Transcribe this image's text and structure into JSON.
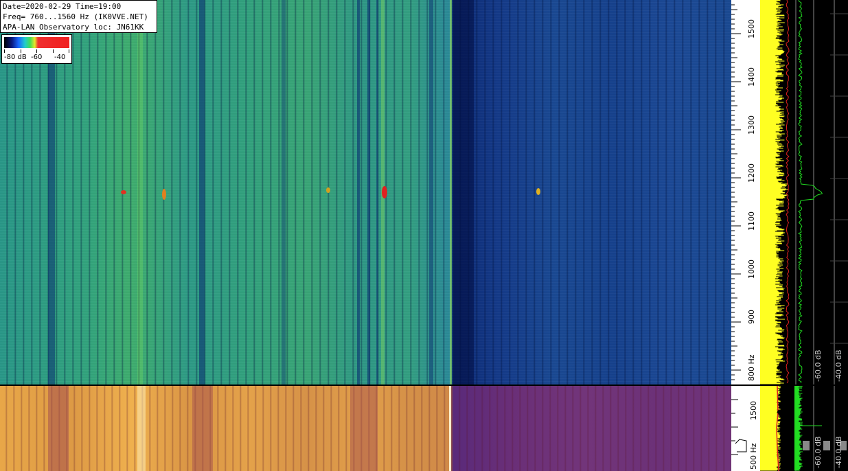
{
  "info": {
    "line1": "Date=2020-02-29 Time=19:00",
    "line2": "Freq= 760...1560 Hz (IK0VVE.NET)",
    "line3": "APA-LAN Observatory loc: JN61KK"
  },
  "legend": {
    "label_a": "-80 dB",
    "label_b": "-60",
    "label_c": "-40"
  },
  "axis_top": {
    "labels": [
      "1500",
      "1400",
      "1300",
      "1200",
      "1100",
      "1000",
      "900",
      "800 Hz"
    ]
  },
  "axis_bottom": {
    "labels": [
      "1500",
      "500 Hz"
    ]
  },
  "spectrum_top": {
    "db_left": "-60.0 dB",
    "db_right": "-40.0 dB"
  },
  "spectrum_bottom": {
    "db_left": "-60.0 dB",
    "db_right": "-40.0 dB"
  },
  "colors": {
    "wf_top_left": "#33a67f",
    "wf_top_right": "#1a4a94",
    "wf_bottom_left": "#e8a748",
    "wf_bottom_right": "#6c3178",
    "spectrum_yellow": "#ffff22",
    "spectrum_green": "#22dd22",
    "peak_red": "#e02020"
  }
}
